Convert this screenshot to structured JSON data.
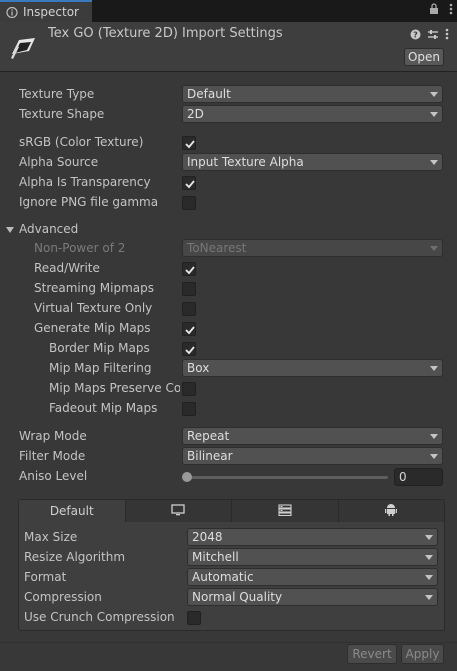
{
  "tab": {
    "title": "Inspector",
    "icons": [
      "info-icon",
      "lock-icon",
      "more-icon"
    ]
  },
  "header": {
    "title": "Tex GO (Texture 2D) Import Settings",
    "open_label": "Open",
    "tool_icons": [
      "help-icon",
      "preset-icon",
      "kebab-icon"
    ]
  },
  "fields": {
    "texture_type": {
      "label": "Texture Type",
      "value": "Default"
    },
    "texture_shape": {
      "label": "Texture Shape",
      "value": "2D"
    },
    "srgb": {
      "label": "sRGB (Color Texture)",
      "checked": true
    },
    "alpha_source": {
      "label": "Alpha Source",
      "value": "Input Texture Alpha"
    },
    "alpha_is_transparency": {
      "label": "Alpha Is Transparency",
      "checked": true
    },
    "ignore_png_gamma": {
      "label": "Ignore PNG file gamma",
      "checked": false
    }
  },
  "advanced": {
    "label": "Advanced",
    "non_power_of_2": {
      "label": "Non-Power of 2",
      "value": "ToNearest"
    },
    "read_write": {
      "label": "Read/Write",
      "checked": true
    },
    "streaming_mipmaps": {
      "label": "Streaming Mipmaps",
      "checked": false
    },
    "virtual_texture_only": {
      "label": "Virtual Texture Only",
      "checked": false
    },
    "generate_mip_maps": {
      "label": "Generate Mip Maps",
      "checked": true
    },
    "border_mip_maps": {
      "label": "Border Mip Maps",
      "checked": true
    },
    "mip_map_filtering": {
      "label": "Mip Map Filtering",
      "value": "Box"
    },
    "mip_maps_preserve_coverage": {
      "label": "Mip Maps Preserve Coverage",
      "checked": false
    },
    "fadeout_mip_maps": {
      "label": "Fadeout Mip Maps",
      "checked": false
    }
  },
  "wrap": {
    "wrap_mode": {
      "label": "Wrap Mode",
      "value": "Repeat"
    },
    "filter_mode": {
      "label": "Filter Mode",
      "value": "Bilinear"
    },
    "aniso_level": {
      "label": "Aniso Level",
      "value": "0"
    }
  },
  "platform": {
    "tabs": [
      {
        "label": "Default",
        "icon": ""
      },
      {
        "label": "",
        "icon": "monitor-icon"
      },
      {
        "label": "",
        "icon": "server-icon"
      },
      {
        "label": "",
        "icon": "android-icon"
      }
    ],
    "max_size": {
      "label": "Max Size",
      "value": "2048"
    },
    "resize_algorithm": {
      "label": "Resize Algorithm",
      "value": "Mitchell"
    },
    "format": {
      "label": "Format",
      "value": "Automatic"
    },
    "compression": {
      "label": "Compression",
      "value": "Normal Quality"
    },
    "use_crunch": {
      "label": "Use Crunch Compression",
      "checked": false
    }
  },
  "footer": {
    "revert_label": "Revert",
    "apply_label": "Apply"
  },
  "colors": {
    "accent": "#3a79bb",
    "panel": "#383838",
    "field": "#515151"
  }
}
